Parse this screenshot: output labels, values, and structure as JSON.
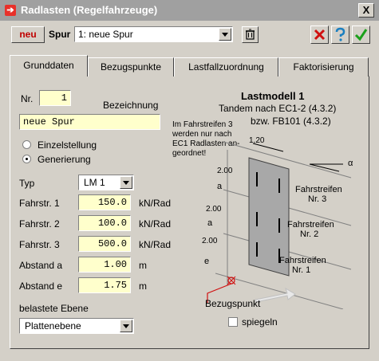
{
  "window": {
    "title": "Radlasten (Regelfahrzeuge)",
    "close_glyph": "X"
  },
  "toolbar": {
    "new_label": "neu",
    "spur_label": "Spur",
    "spur_value": "1: neue Spur"
  },
  "tabs": [
    "Grunddaten",
    "Bezugspunkte",
    "Lastfallzuordnung",
    "Faktorisierung"
  ],
  "form": {
    "nr_label": "Nr.",
    "nr_value": "1",
    "bezeichnung_label": "Bezeichnung",
    "bezeichnung_value": "neue Spur",
    "radio_einzel": "Einzelstellung",
    "radio_gener": "Generierung",
    "typ_label": "Typ",
    "typ_value": "LM 1",
    "rows": [
      {
        "label": "Fahrstr. 1",
        "value": "150.0",
        "unit": "kN/Rad"
      },
      {
        "label": "Fahrstr. 2",
        "value": "100.0",
        "unit": "kN/Rad"
      },
      {
        "label": "Fahrstr. 3",
        "value": "500.0",
        "unit": "kN/Rad"
      },
      {
        "label": "Abstand a",
        "value": "1.00",
        "unit": "m"
      },
      {
        "label": "Abstand e",
        "value": "1.75",
        "unit": "m"
      }
    ],
    "ebene_label": "belastete Ebene",
    "ebene_value": "Plattenebene"
  },
  "diagram": {
    "title": "Lastmodell  1",
    "line1": "Tandem nach EC1-2 (4.3.2)",
    "line2": "bzw.  FB101 (4.3.2)",
    "note1": "Im Fahrstreifen 3",
    "note2": "werden nur nach",
    "note3": "EC1 Radlasten an-",
    "note4": "geordnet!",
    "dim_top": "1,20",
    "dim_200a": "2.00",
    "dim_a1": "a",
    "dim_200b": "2.00",
    "dim_a2": "a",
    "dim_200c": "2.00",
    "dim_e": "e",
    "alpha": "α",
    "fs3a": "Fahrstreifen",
    "fs3b": "Nr. 3",
    "fs2a": "Fahrstreifen",
    "fs2b": "Nr. 2",
    "fs1a": "Fahrstreifen",
    "fs1b": "Nr. 1",
    "bezugspunkt": "Bezugspunkt",
    "spiegeln": "spiegeln"
  }
}
